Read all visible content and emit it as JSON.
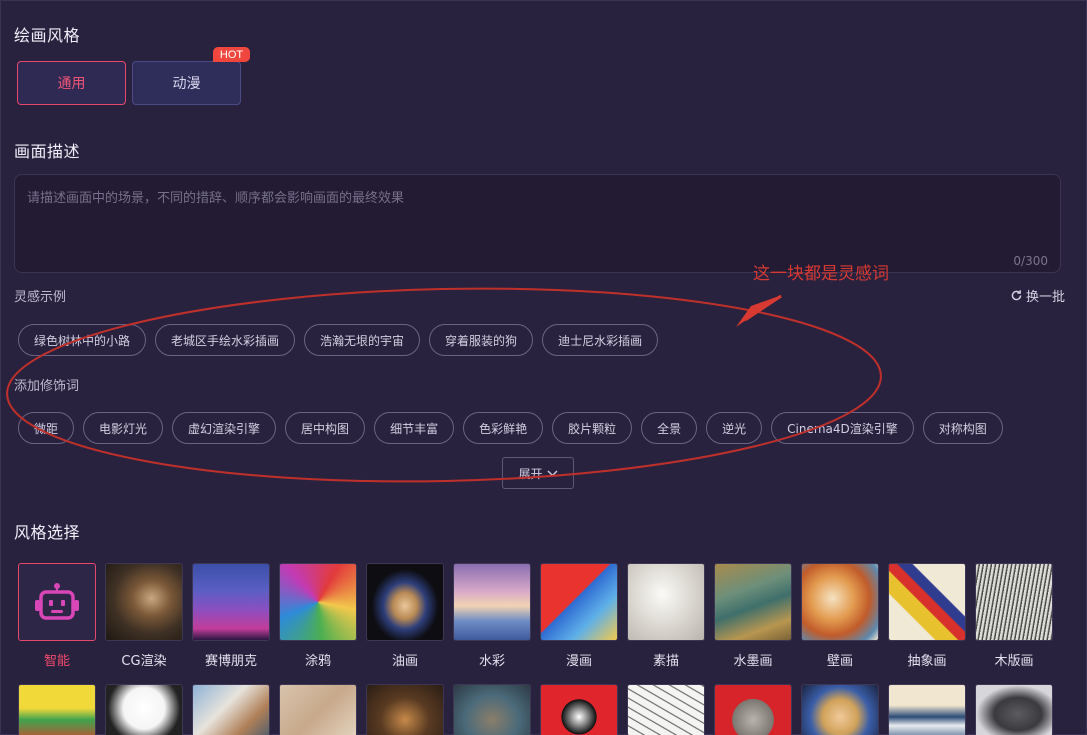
{
  "sections": {
    "painting_style": "绘画风格",
    "picture_description": "画面描述",
    "inspiration_examples": "灵感示例",
    "add_modifiers": "添加修饰词",
    "style_selection": "风格选择"
  },
  "style_tabs": [
    {
      "label": "通用",
      "active": true
    },
    {
      "label": "动漫",
      "active": false
    }
  ],
  "hot_badge": "HOT",
  "description": {
    "placeholder": "请描述画面中的场景，不同的措辞、顺序都会影响画面的最终效果",
    "value": "",
    "counter": "0/300"
  },
  "refresh_label": "换一批",
  "inspiration_tags": [
    "绿色树林中的小路",
    "老城区手绘水彩插画",
    "浩瀚无垠的宇宙",
    "穿着服装的狗",
    "迪士尼水彩插画"
  ],
  "modifier_tags": [
    "微距",
    "电影灯光",
    "虚幻渲染引擎",
    "居中构图",
    "细节丰富",
    "色彩鲜艳",
    "胶片颗粒",
    "全景",
    "逆光",
    "Cinema4D渲染引擎",
    "对称构图"
  ],
  "expand_label": "展开",
  "annotation": "这一块都是灵感词",
  "styles": [
    {
      "label": "智能",
      "icon": "robot-icon",
      "selected": true
    },
    {
      "label": "CG渲染",
      "selected": false
    },
    {
      "label": "赛博朋克",
      "selected": false
    },
    {
      "label": "涂鸦",
      "selected": false
    },
    {
      "label": "油画",
      "selected": false
    },
    {
      "label": "水彩",
      "selected": false
    },
    {
      "label": "漫画",
      "selected": false
    },
    {
      "label": "素描",
      "selected": false
    },
    {
      "label": "水墨画",
      "selected": false
    },
    {
      "label": "壁画",
      "selected": false
    },
    {
      "label": "抽象画",
      "selected": false
    },
    {
      "label": "木版画",
      "selected": false
    }
  ],
  "colors": {
    "background": "#29223f",
    "accent": "#e8466b",
    "annotation_red": "#d83a32",
    "hot_badge": "#f0463e"
  }
}
